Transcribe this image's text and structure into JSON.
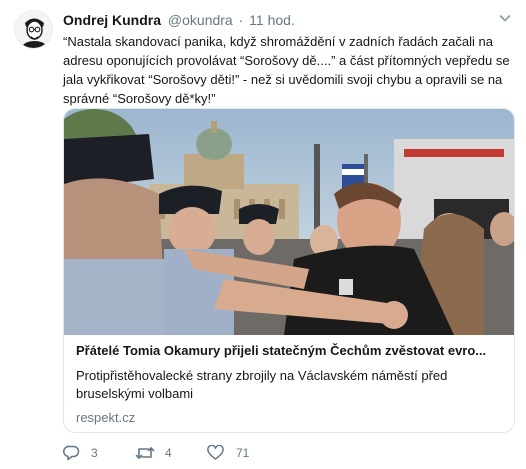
{
  "tweet": {
    "author_name": "Ondrej Kundra",
    "handle": "@okundra",
    "separator": "·",
    "time": "11 hod.",
    "text": "“Nastala skandovací panika, když shromáždění v zadních řadách začali na adresu oponujících provolávat “Sorošovy dě....” a část přítomných vepředu se jala vykřikovat “Sorošovy děti!” - než si uvědomili svoji chybu a opravili se na správné “Sorošovy dě*ky!”"
  },
  "card": {
    "title": "Přátelé Tomia Okamury přijeli statečným Čechům zvěstovat evro...",
    "description": "Protipřistěhovalecké strany zbrojily na Václavském náměstí před bruselskými volbami",
    "domain": "respekt.cz"
  },
  "actions": {
    "reply_count": "3",
    "retweet_count": "4",
    "like_count": "71"
  },
  "icons": {
    "avatar": "avatar-portrait-icon",
    "more": "chevron-down-icon",
    "reply": "reply-icon",
    "retweet": "retweet-icon",
    "like": "heart-icon"
  },
  "colors": {
    "text": "#14171a",
    "secondary": "#657786",
    "border": "#e1e8ed",
    "icon": "#657786"
  }
}
